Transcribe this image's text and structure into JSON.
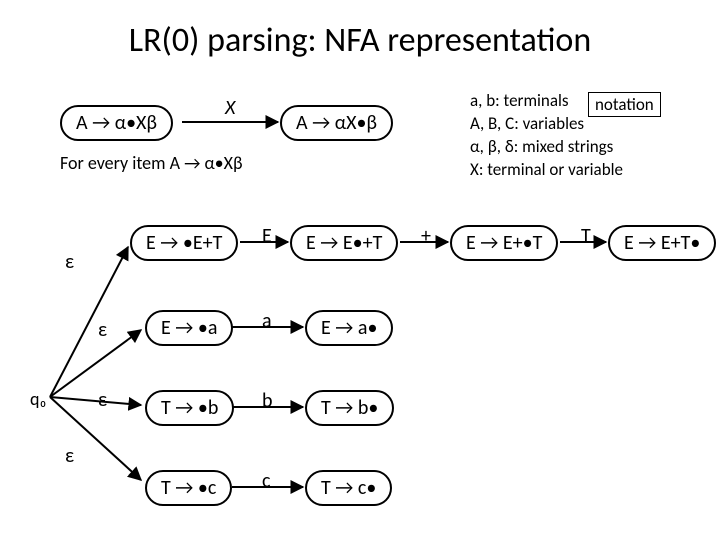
{
  "title": "LR(0) parsing: NFA representation",
  "generic": {
    "state_left": "A → α•Xβ",
    "edge_X": "X",
    "state_right": "A → αX•β",
    "caption": "For every item A → α•Xβ"
  },
  "legend": {
    "box": "notation",
    "l1": "a, b: terminals",
    "l2": "A, B, C: variables",
    "l3": "α, β, δ: mixed strings",
    "l4": "X: terminal or variable"
  },
  "q0_label": "q₀",
  "eps": "ε",
  "chain": {
    "n1": "E → •E+T",
    "e1": "E",
    "n2": "E → E•+T",
    "e2": "+",
    "n3": "E → E+•T",
    "e3": "T",
    "n4": "E → E+T•"
  },
  "rowEa": {
    "left": "E → •a",
    "edge": "a",
    "right": "E → a•"
  },
  "rowTb": {
    "left": "T → •b",
    "edge": "b",
    "right": "T → b•"
  },
  "rowTc": {
    "left": "T → •c",
    "edge": "c",
    "right": "T → c•"
  }
}
